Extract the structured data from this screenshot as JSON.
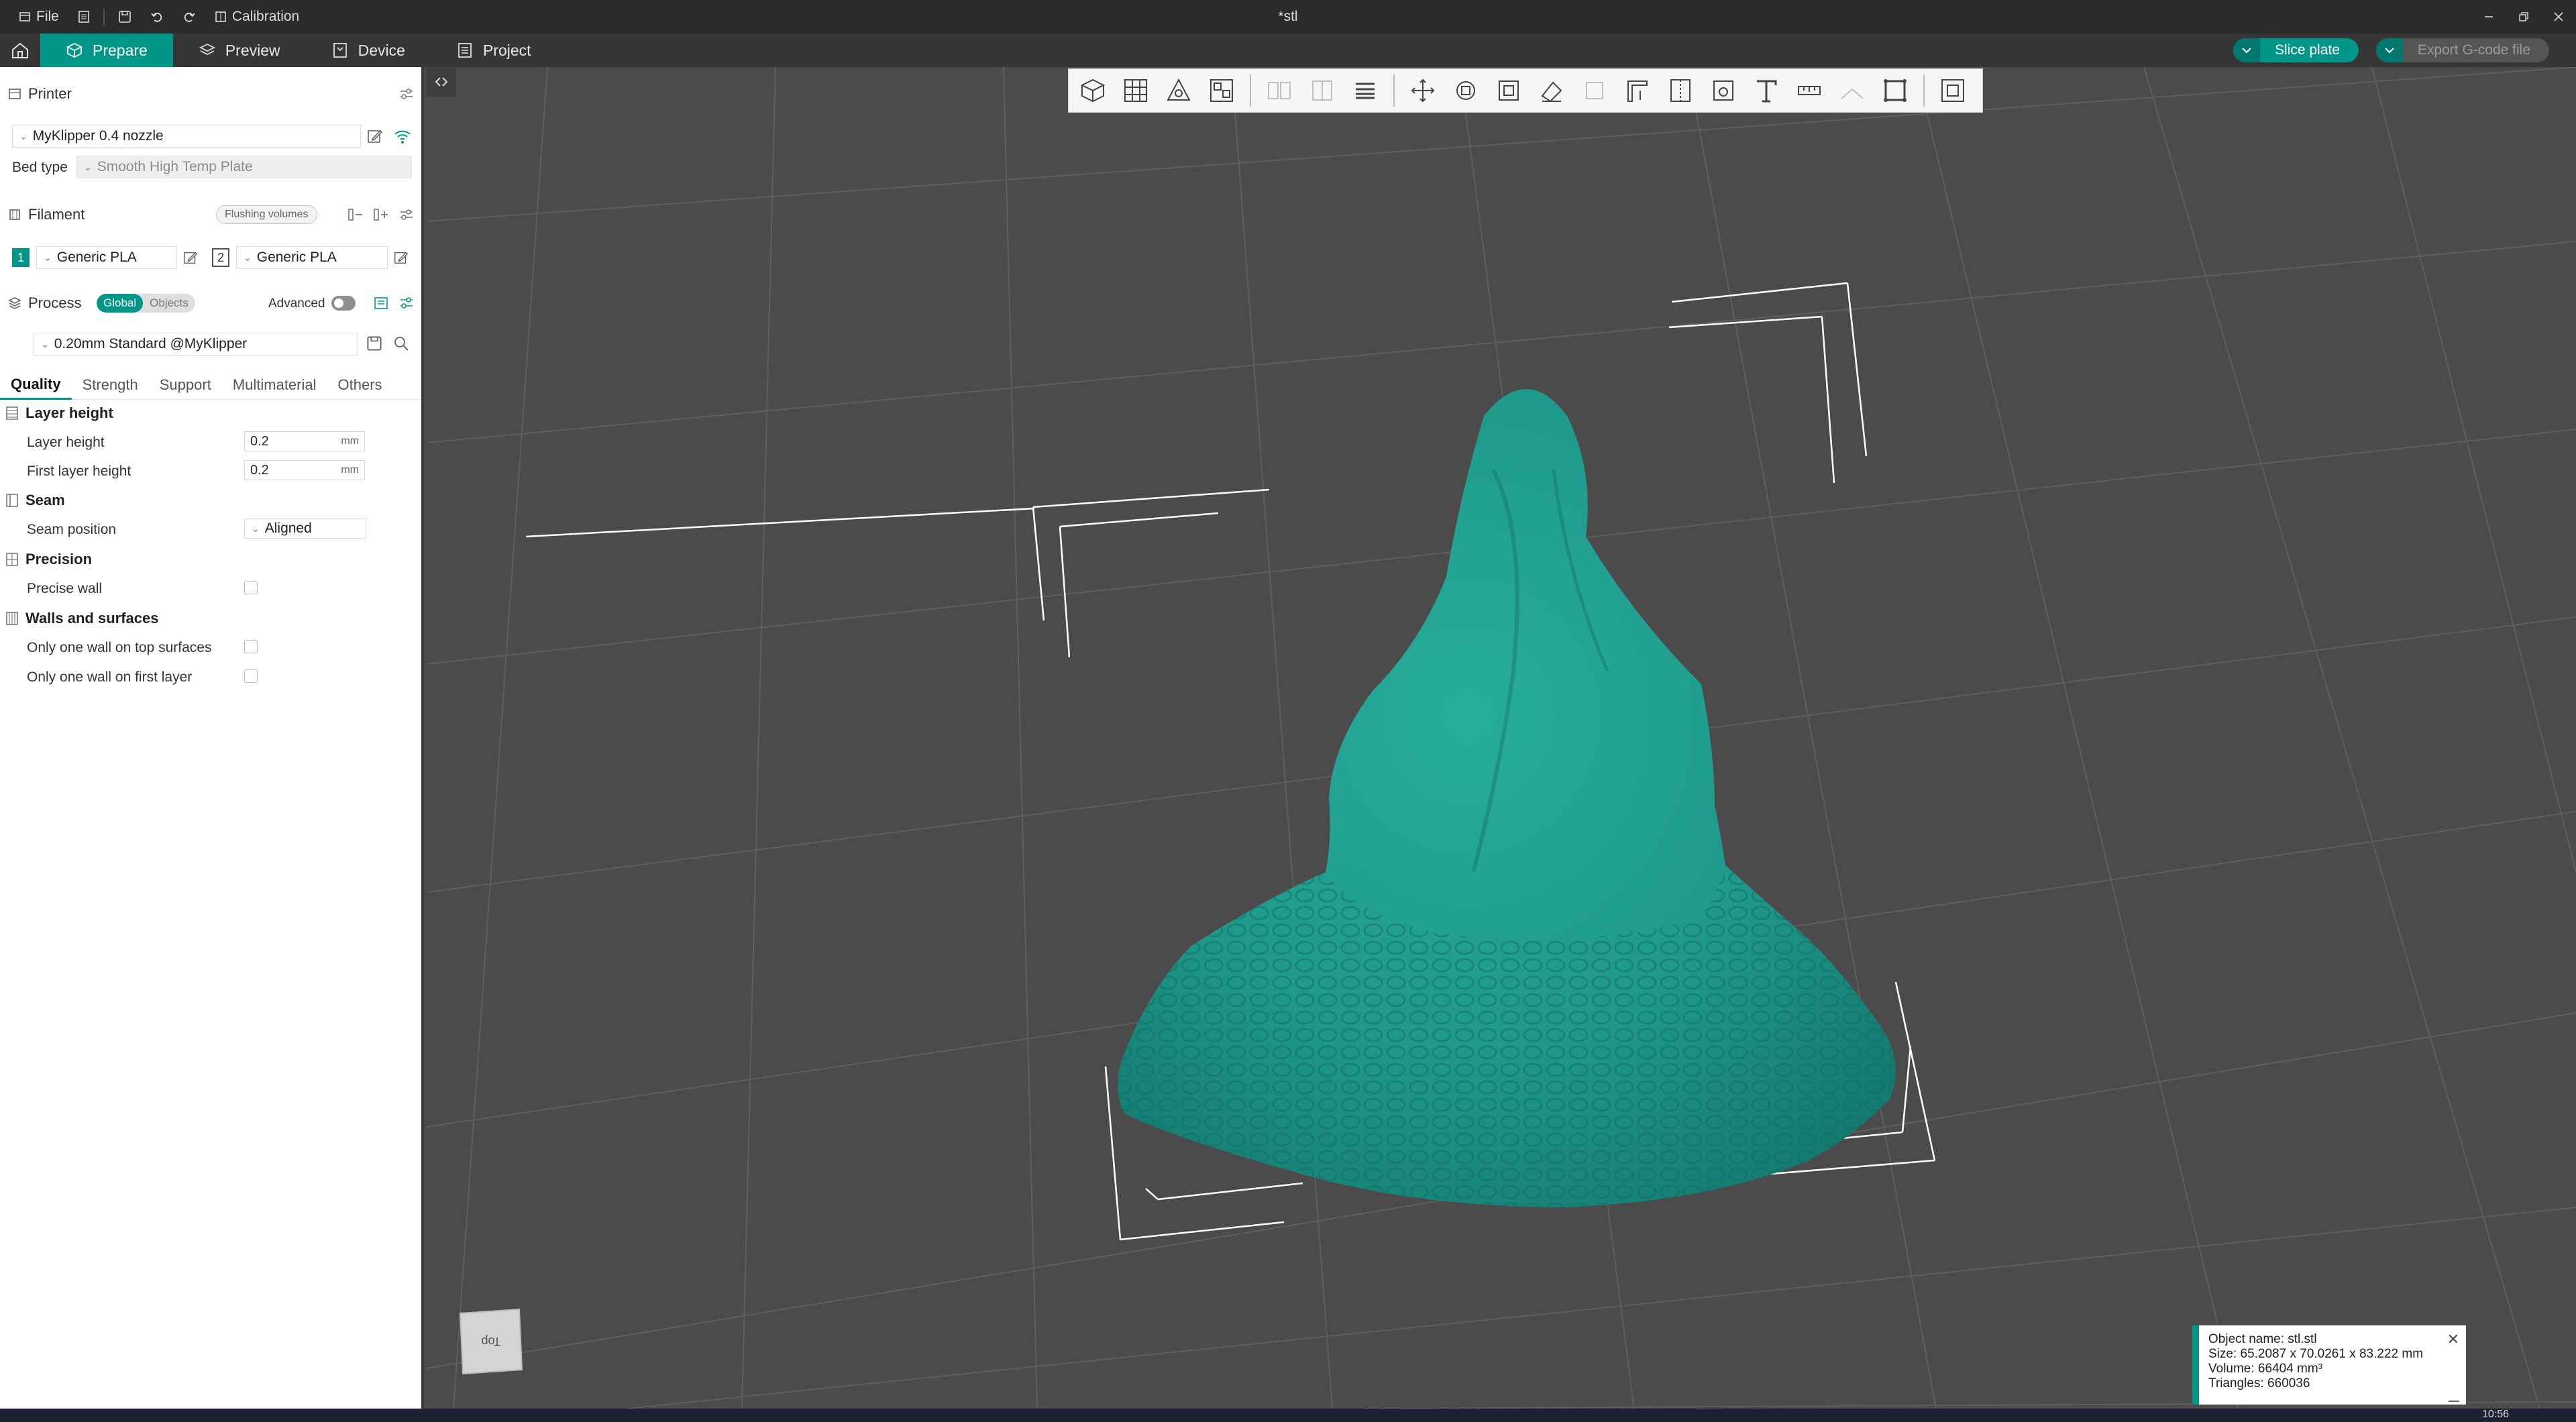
{
  "titlebar": {
    "file_label": "File",
    "calibration_label": "Calibration",
    "doc_title": "*stl"
  },
  "menubar": {
    "tabs": [
      {
        "label": "Prepare",
        "active": true,
        "icon": "cube-icon"
      },
      {
        "label": "Preview",
        "active": false,
        "icon": "layers-icon"
      },
      {
        "label": "Device",
        "active": false,
        "icon": "device-icon"
      },
      {
        "label": "Project",
        "active": false,
        "icon": "project-icon"
      }
    ],
    "slice_label": "Slice plate",
    "export_label": "Export G-code file"
  },
  "sidebar": {
    "printer": {
      "title": "Printer",
      "preset": "MyKlipper 0.4 nozzle",
      "bed_type_label": "Bed type",
      "bed_type_value": "Smooth High Temp Plate"
    },
    "filament": {
      "title": "Filament",
      "flushing_label": "Flushing volumes",
      "slots": [
        {
          "num": "1",
          "name": "Generic PLA"
        },
        {
          "num": "2",
          "name": "Generic PLA"
        }
      ]
    },
    "process": {
      "title": "Process",
      "global_label": "Global",
      "objects_label": "Objects",
      "advanced_label": "Advanced",
      "preset": "0.20mm Standard @MyKlipper"
    },
    "tabs": [
      "Quality",
      "Strength",
      "Support",
      "Multimaterial",
      "Others"
    ],
    "groups": {
      "layer_height": {
        "title": "Layer height",
        "layer_height_label": "Layer height",
        "layer_height_value": "0.2",
        "first_layer_label": "First layer height",
        "first_layer_value": "0.2",
        "unit": "mm"
      },
      "seam": {
        "title": "Seam",
        "position_label": "Seam position",
        "position_value": "Aligned"
      },
      "precision": {
        "title": "Precision",
        "precise_wall_label": "Precise wall"
      },
      "walls": {
        "title": "Walls and surfaces",
        "one_wall_top_label": "Only one wall on top surfaces",
        "one_wall_first_label": "Only one wall on first layer"
      }
    }
  },
  "viewport": {
    "view_cube_label": "Top",
    "model_color": "#1f9a8c",
    "info": {
      "name": "Object name: stl.stl",
      "size": "Size: 65.2087 x 70.0261 x 83.222 mm",
      "volume": "Volume: 66404 mm³",
      "triangles": "Triangles: 660036"
    }
  },
  "taskbar": {
    "clock": "10:56"
  },
  "colors": {
    "accent": "#009688",
    "titlebar_bg": "#2b2b2b",
    "menubar_bg": "#363636",
    "viewport_bg": "#4b4b4b"
  }
}
